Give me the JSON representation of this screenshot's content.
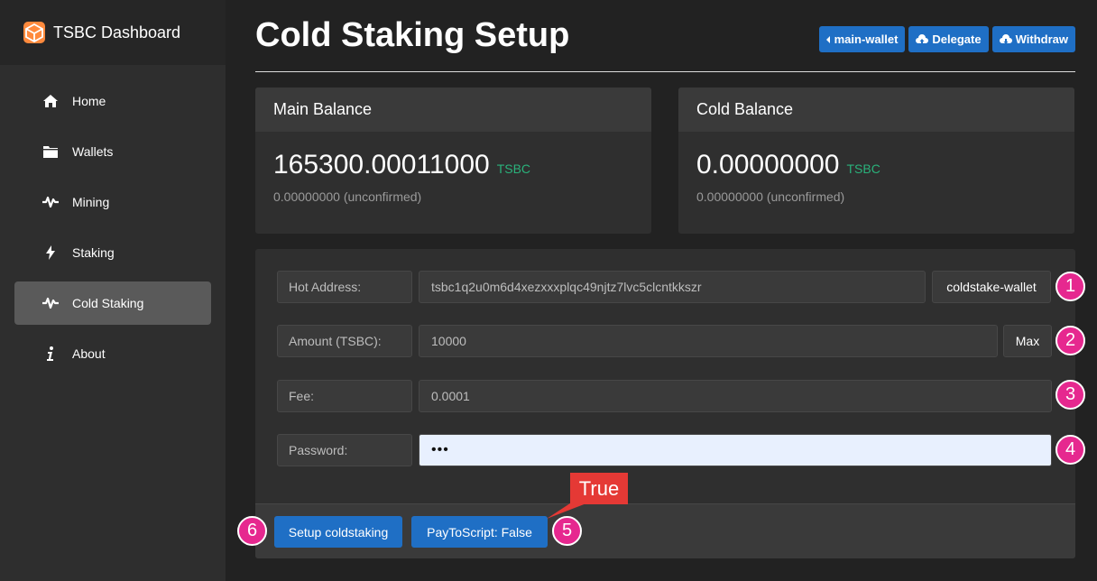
{
  "app": {
    "brand": "TSBC Dashboard"
  },
  "sidebar": {
    "items": [
      {
        "label": "Home",
        "icon": "home-icon"
      },
      {
        "label": "Wallets",
        "icon": "folder-icon"
      },
      {
        "label": "Mining",
        "icon": "pulse-icon"
      },
      {
        "label": "Staking",
        "icon": "bolt-icon"
      },
      {
        "label": "Cold Staking",
        "icon": "pulse-icon",
        "active": true
      },
      {
        "label": "About",
        "icon": "info-icon"
      }
    ]
  },
  "header": {
    "title": "Cold Staking Setup",
    "buttons": {
      "wallet": "main-wallet",
      "delegate": "Delegate",
      "withdraw": "Withdraw"
    }
  },
  "cards": {
    "main": {
      "title": "Main Balance",
      "amount": "165300.00011000",
      "unit": "TSBC",
      "unconfirmed": "0.00000000 (unconfirmed)"
    },
    "cold": {
      "title": "Cold Balance",
      "amount": "0.00000000",
      "unit": "TSBC",
      "unconfirmed": "0.00000000 (unconfirmed)"
    }
  },
  "form": {
    "hot_address": {
      "label": "Hot Address:",
      "value": "tsbc1q2u0m6d4xezxxxplqc49njtz7lvc5clcntkkszr",
      "button": "coldstake-wallet"
    },
    "amount": {
      "label": "Amount (TSBC):",
      "value": "10000",
      "button": "Max"
    },
    "fee": {
      "label": "Fee:",
      "value": "0.0001"
    },
    "password": {
      "label": "Password:",
      "value": "•••"
    },
    "setup_button": "Setup coldstaking",
    "p2s_button": "PayToScript: False"
  },
  "annotations": {
    "badges": [
      "1",
      "2",
      "3",
      "4",
      "5",
      "6"
    ],
    "callout": "True"
  },
  "colors": {
    "accent": "#1f6fc5",
    "badge": "#e6288f",
    "callout": "#e53935",
    "unit": "#2ab27b"
  }
}
